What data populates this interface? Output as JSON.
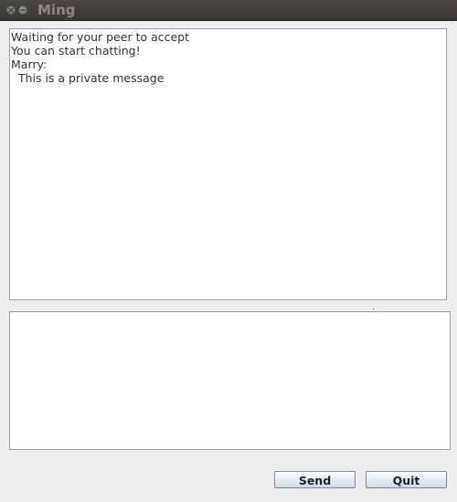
{
  "window": {
    "title": "Ming"
  },
  "chat_log": {
    "lines": [
      "Waiting for your peer to accept",
      "You can start chatting!",
      "Marry:",
      "  This is a private message"
    ]
  },
  "compose": {
    "value": ""
  },
  "buttons": {
    "send_label": "Send",
    "quit_label": "Quit"
  },
  "icons": {
    "close": "close-icon",
    "minimize": "minimize-icon"
  }
}
